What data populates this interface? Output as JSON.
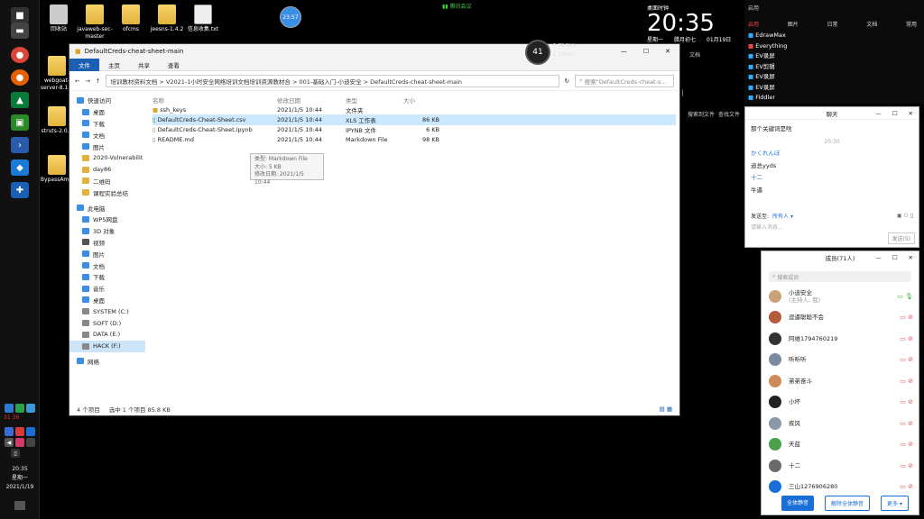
{
  "desktop": {
    "icons": [
      {
        "label": "回收站"
      },
      {
        "label": "javaweb-sec-master"
      },
      {
        "label": "ofcms"
      },
      {
        "label": "jeesns-1.4.2"
      },
      {
        "label": "信息收集.txt"
      },
      {
        "label": "webgoat-server-8.1.0"
      },
      {
        "label": "struts-2.0..."
      },
      {
        "label": "BypassAmsi"
      }
    ]
  },
  "topbar": {
    "meeting_label": "腾讯会议",
    "circle_value": "23:57"
  },
  "speed_widget": {
    "percent": "41",
    "up": "75.1k/s",
    "down": "125k/s"
  },
  "clock": {
    "header": "桌面时钟",
    "time": "20:35",
    "day": "星期一",
    "lunar": "腊月初七",
    "date": "01月19日"
  },
  "launcher": {
    "title": "启用",
    "tabs": [
      "启用",
      "图片",
      "日常",
      "文档",
      "常用"
    ],
    "items": [
      "EdrawMax",
      "Everything",
      "EV录屏",
      "EV剪辑",
      "EV录屏",
      "EV录屏",
      "Fiddler"
    ],
    "doc_label": "文档",
    "bottom_labels": [
      "搜索到文件",
      "查找文件"
    ]
  },
  "explorer": {
    "title": "DefaultCreds-cheat-sheet-main",
    "ribbon": [
      "文件",
      "主页",
      "共享",
      "查看"
    ],
    "address": "培训教材资料文档  >  V2021-1小时安全网络培训文档培训资源教材合  >  001-基础入门-小迪安全  >  DefaultCreds-cheat-sheet-main",
    "search_placeholder": "搜索\"DefaultCreds-cheat-s...",
    "nav": [
      "快速访问",
      "桌面",
      "下载",
      "文档",
      "图片",
      "2020-Vulnerabilit",
      "day86",
      "二维码",
      "课程实验总结",
      "此电脑",
      "WPS网盘",
      "3D 对象",
      "视频",
      "图片",
      "文档",
      "下载",
      "音乐",
      "桌面",
      "SYSTEM (C:)",
      "SOFT (D:)",
      "DATA (E:)",
      "HACK (F:)",
      "网络"
    ],
    "columns": [
      "名称",
      "修改日期",
      "类型",
      "大小"
    ],
    "files": [
      {
        "name": "ssh_keys",
        "date": "2021/1/5 10:44",
        "type": "文件夹",
        "size": ""
      },
      {
        "name": "DefaultCreds-Cheat-Sheet.csv",
        "date": "2021/1/5 10:44",
        "type": "XLS 工作表",
        "size": "86 KB"
      },
      {
        "name": "DefaultCreds-Cheat-Sheet.ipynb",
        "date": "2021/1/5 10:44",
        "type": "IPYNB 文件",
        "size": "6 KB"
      },
      {
        "name": "README.md",
        "date": "2021/1/5 10:44",
        "type": "Markdown File",
        "size": "98 KB"
      }
    ],
    "tooltip": [
      "类型: Markdown File",
      "大小: 5 KB",
      "修改日期: 2021/1/5 10:44"
    ],
    "status_count": "4 个项目",
    "status_selected": "选中 1 个项目  85.8 KB"
  },
  "chat": {
    "title": "聊天",
    "messages": [
      "那个关键词是啥",
      "20:30",
      "かくれんぼ",
      "迪总yyds",
      "十二",
      "牛逼"
    ],
    "send_to_label": "发送至:",
    "send_to_value": "所有人",
    "input_placeholder": "请输入消息...",
    "send_button": "发送(S)"
  },
  "members": {
    "title": "成员(71人)",
    "search_placeholder": "搜索成员",
    "list": [
      {
        "name": "小迪安全",
        "sub": "(主持人, 我)",
        "color": "#c9a27a"
      },
      {
        "name": "逗逼聪聪不会",
        "sub": "",
        "color": "#b55a3a"
      },
      {
        "name": "阿维1794760219",
        "sub": "",
        "color": "#333333"
      },
      {
        "name": "听听听",
        "sub": "",
        "color": "#7a8aa0"
      },
      {
        "name": "弟弟奋斗",
        "sub": "",
        "color": "#d08a5a"
      },
      {
        "name": "小坏",
        "sub": "",
        "color": "#222222"
      },
      {
        "name": "疾风",
        "sub": "",
        "color": "#8a98a8"
      },
      {
        "name": "天蓝",
        "sub": "",
        "color": "#4aa04a"
      },
      {
        "name": "十二",
        "sub": "",
        "color": "#6a6a6a"
      },
      {
        "name": "三山1276906280",
        "sub": "",
        "color": "#1a6fd6"
      }
    ],
    "mute_all": "全体静音",
    "unmute_all": "解除全体静音",
    "more": "更多"
  },
  "taskbar": {
    "time": "20:35",
    "day": "星期一",
    "date": "2021/1/19",
    "tray_numbers": "31 36"
  }
}
